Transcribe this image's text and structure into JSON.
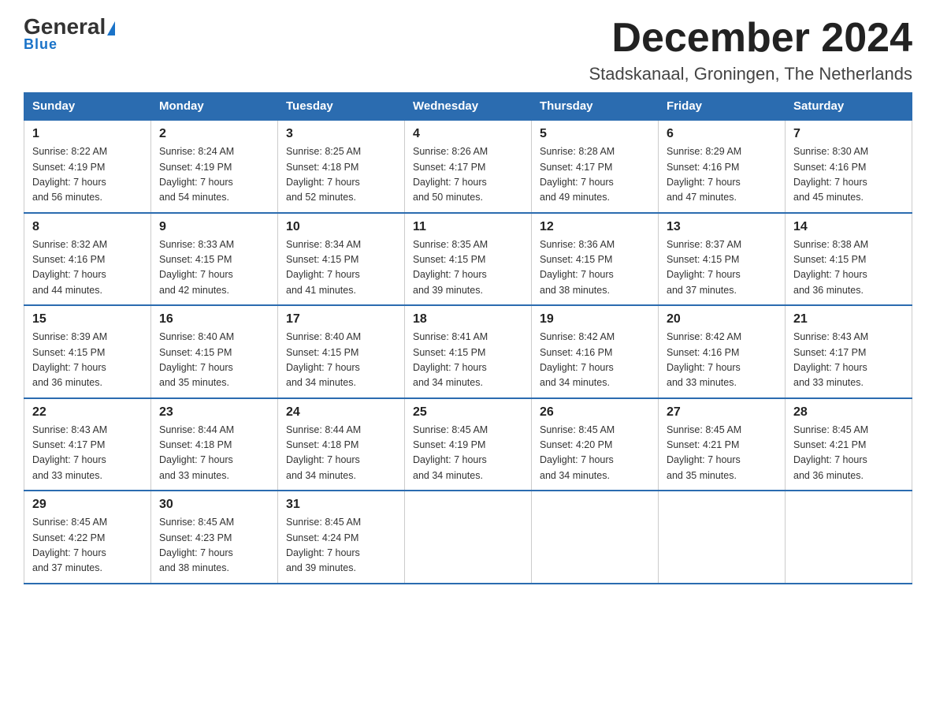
{
  "header": {
    "logo_general": "General",
    "logo_blue": "Blue",
    "month_title": "December 2024",
    "location": "Stadskanaal, Groningen, The Netherlands"
  },
  "days_of_week": [
    "Sunday",
    "Monday",
    "Tuesday",
    "Wednesday",
    "Thursday",
    "Friday",
    "Saturday"
  ],
  "weeks": [
    [
      {
        "day": "1",
        "sunrise": "8:22 AM",
        "sunset": "4:19 PM",
        "daylight": "7 hours and 56 minutes."
      },
      {
        "day": "2",
        "sunrise": "8:24 AM",
        "sunset": "4:19 PM",
        "daylight": "7 hours and 54 minutes."
      },
      {
        "day": "3",
        "sunrise": "8:25 AM",
        "sunset": "4:18 PM",
        "daylight": "7 hours and 52 minutes."
      },
      {
        "day": "4",
        "sunrise": "8:26 AM",
        "sunset": "4:17 PM",
        "daylight": "7 hours and 50 minutes."
      },
      {
        "day": "5",
        "sunrise": "8:28 AM",
        "sunset": "4:17 PM",
        "daylight": "7 hours and 49 minutes."
      },
      {
        "day": "6",
        "sunrise": "8:29 AM",
        "sunset": "4:16 PM",
        "daylight": "7 hours and 47 minutes."
      },
      {
        "day": "7",
        "sunrise": "8:30 AM",
        "sunset": "4:16 PM",
        "daylight": "7 hours and 45 minutes."
      }
    ],
    [
      {
        "day": "8",
        "sunrise": "8:32 AM",
        "sunset": "4:16 PM",
        "daylight": "7 hours and 44 minutes."
      },
      {
        "day": "9",
        "sunrise": "8:33 AM",
        "sunset": "4:15 PM",
        "daylight": "7 hours and 42 minutes."
      },
      {
        "day": "10",
        "sunrise": "8:34 AM",
        "sunset": "4:15 PM",
        "daylight": "7 hours and 41 minutes."
      },
      {
        "day": "11",
        "sunrise": "8:35 AM",
        "sunset": "4:15 PM",
        "daylight": "7 hours and 39 minutes."
      },
      {
        "day": "12",
        "sunrise": "8:36 AM",
        "sunset": "4:15 PM",
        "daylight": "7 hours and 38 minutes."
      },
      {
        "day": "13",
        "sunrise": "8:37 AM",
        "sunset": "4:15 PM",
        "daylight": "7 hours and 37 minutes."
      },
      {
        "day": "14",
        "sunrise": "8:38 AM",
        "sunset": "4:15 PM",
        "daylight": "7 hours and 36 minutes."
      }
    ],
    [
      {
        "day": "15",
        "sunrise": "8:39 AM",
        "sunset": "4:15 PM",
        "daylight": "7 hours and 36 minutes."
      },
      {
        "day": "16",
        "sunrise": "8:40 AM",
        "sunset": "4:15 PM",
        "daylight": "7 hours and 35 minutes."
      },
      {
        "day": "17",
        "sunrise": "8:40 AM",
        "sunset": "4:15 PM",
        "daylight": "7 hours and 34 minutes."
      },
      {
        "day": "18",
        "sunrise": "8:41 AM",
        "sunset": "4:15 PM",
        "daylight": "7 hours and 34 minutes."
      },
      {
        "day": "19",
        "sunrise": "8:42 AM",
        "sunset": "4:16 PM",
        "daylight": "7 hours and 34 minutes."
      },
      {
        "day": "20",
        "sunrise": "8:42 AM",
        "sunset": "4:16 PM",
        "daylight": "7 hours and 33 minutes."
      },
      {
        "day": "21",
        "sunrise": "8:43 AM",
        "sunset": "4:17 PM",
        "daylight": "7 hours and 33 minutes."
      }
    ],
    [
      {
        "day": "22",
        "sunrise": "8:43 AM",
        "sunset": "4:17 PM",
        "daylight": "7 hours and 33 minutes."
      },
      {
        "day": "23",
        "sunrise": "8:44 AM",
        "sunset": "4:18 PM",
        "daylight": "7 hours and 33 minutes."
      },
      {
        "day": "24",
        "sunrise": "8:44 AM",
        "sunset": "4:18 PM",
        "daylight": "7 hours and 34 minutes."
      },
      {
        "day": "25",
        "sunrise": "8:45 AM",
        "sunset": "4:19 PM",
        "daylight": "7 hours and 34 minutes."
      },
      {
        "day": "26",
        "sunrise": "8:45 AM",
        "sunset": "4:20 PM",
        "daylight": "7 hours and 34 minutes."
      },
      {
        "day": "27",
        "sunrise": "8:45 AM",
        "sunset": "4:21 PM",
        "daylight": "7 hours and 35 minutes."
      },
      {
        "day": "28",
        "sunrise": "8:45 AM",
        "sunset": "4:21 PM",
        "daylight": "7 hours and 36 minutes."
      }
    ],
    [
      {
        "day": "29",
        "sunrise": "8:45 AM",
        "sunset": "4:22 PM",
        "daylight": "7 hours and 37 minutes."
      },
      {
        "day": "30",
        "sunrise": "8:45 AM",
        "sunset": "4:23 PM",
        "daylight": "7 hours and 38 minutes."
      },
      {
        "day": "31",
        "sunrise": "8:45 AM",
        "sunset": "4:24 PM",
        "daylight": "7 hours and 39 minutes."
      },
      null,
      null,
      null,
      null
    ]
  ],
  "labels": {
    "sunrise": "Sunrise:",
    "sunset": "Sunset:",
    "daylight": "Daylight:"
  }
}
